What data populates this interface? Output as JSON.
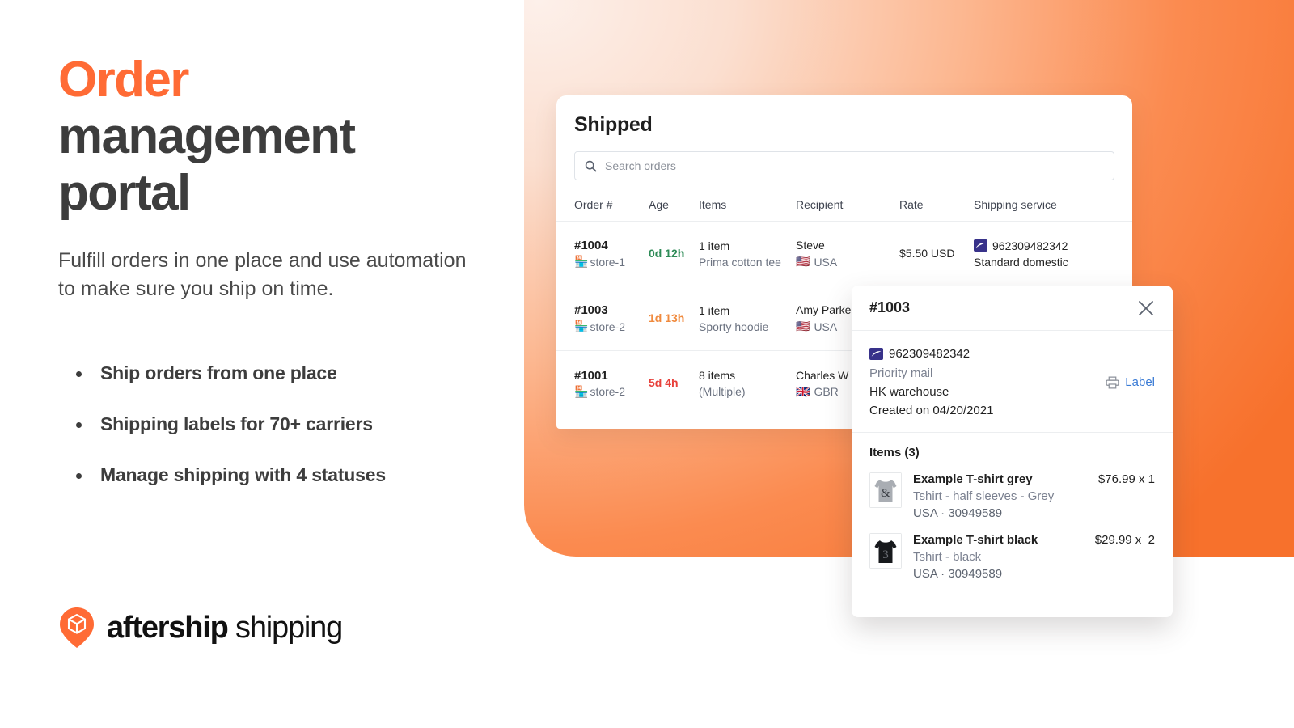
{
  "hero": {
    "headline_accent": "Order",
    "headline_rest_line1": "management",
    "headline_rest_line2": "portal",
    "subhead": "Fulfill orders in one place and use automation to make sure you ship on time.",
    "bullets": [
      "Ship orders from one place",
      "Shipping labels for 70+ carriers",
      "Manage shipping with 4 statuses"
    ],
    "accent_color": "#ff6b35",
    "text_color": "#3d3d3d"
  },
  "logo": {
    "brand_bold": "aftership",
    "brand_light": " shipping",
    "mark": "aftership-pin-cube-icon",
    "mark_color": "#ff6b35"
  },
  "orders_card": {
    "title": "Shipped",
    "search": {
      "placeholder": "Search orders",
      "value": "",
      "icon": "search-icon"
    },
    "columns": [
      "Order #",
      "Age",
      "Items",
      "Recipient",
      "Rate",
      "Shipping service"
    ],
    "rows": [
      {
        "order_number": "#1004",
        "store": "store-1",
        "age": "0d 12h",
        "age_state": "green",
        "items_count": "1 item",
        "items_desc": "Prima cotton tee",
        "recipient_name": "Steve",
        "recipient_country": "USA",
        "recipient_flag": "flag-usa-icon",
        "rate": "$5.50 USD",
        "service_tracking": "962309482342",
        "service_name": "Standard domestic",
        "carrier_icon": "usps-icon"
      },
      {
        "order_number": "#1003",
        "store": "store-2",
        "age": "1d 13h",
        "age_state": "orange",
        "items_count": "1 item",
        "items_desc": "Sporty hoodie",
        "recipient_name": "Amy Parker",
        "recipient_country": "USA",
        "recipient_flag": "flag-usa-icon",
        "rate": "",
        "service_tracking": "",
        "service_name": "",
        "carrier_icon": ""
      },
      {
        "order_number": "#1001",
        "store": "store-2",
        "age": "5d 4h",
        "age_state": "red",
        "items_count": "8 items",
        "items_desc": "(Multiple)",
        "recipient_name": "Charles W",
        "recipient_country": "GBR",
        "recipient_flag": "flag-gbr-icon",
        "rate": "",
        "service_tracking": "",
        "service_name": "",
        "carrier_icon": ""
      }
    ]
  },
  "detail_panel": {
    "title": "#1003",
    "close_icon": "close-icon",
    "shipment": {
      "tracking_number": "962309482342",
      "service": "Priority mail",
      "warehouse": "HK warehouse",
      "created": "Created on 04/20/2021",
      "carrier_icon": "usps-icon"
    },
    "label_action": {
      "text": "Label",
      "icon": "printer-icon",
      "color": "#3a7bd5"
    },
    "items_title": "Items (3)",
    "items": [
      {
        "name": "Example T-shirt grey",
        "description": "Tshirt - half sleeves - Grey",
        "meta": "USA · 30949589",
        "price": "$76.99 x 1",
        "thumb": "tshirt-grey-thumbnail"
      },
      {
        "name": "Example T-shirt black",
        "description": "Tshirt - black",
        "meta": "USA · 30949589",
        "price": "$29.99 x  2",
        "thumb": "tshirt-black-thumbnail"
      }
    ]
  }
}
